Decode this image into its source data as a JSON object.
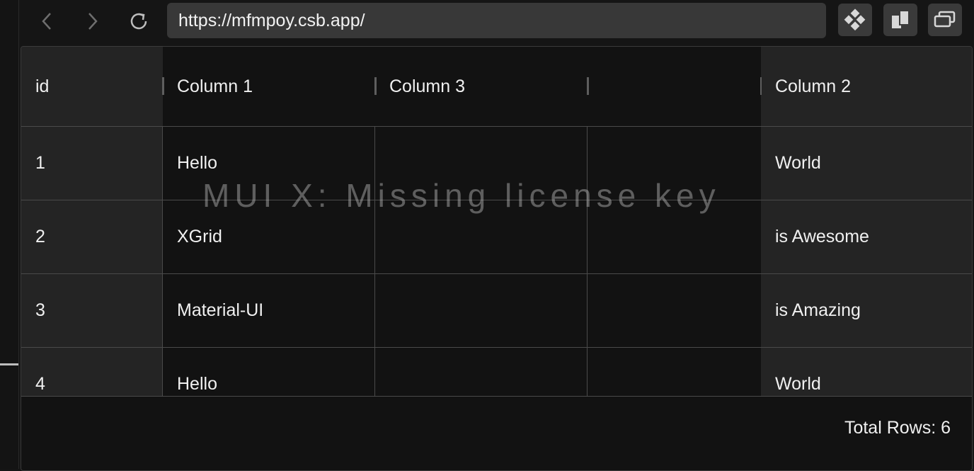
{
  "browser": {
    "url": "https://mfmpoy.csb.app/",
    "back_icon": "chevron-left-icon",
    "forward_icon": "chevron-right-icon",
    "reload_icon": "reload-icon",
    "toolbar_icons": [
      "diamond-grid-icon",
      "split-panels-icon",
      "windows-icon"
    ]
  },
  "grid": {
    "columns": [
      {
        "key": "id",
        "label": "id"
      },
      {
        "key": "col1",
        "label": "Column 1"
      },
      {
        "key": "col3",
        "label": "Column 3"
      },
      {
        "key": "blank",
        "label": ""
      },
      {
        "key": "col2",
        "label": "Column 2"
      }
    ],
    "rows": [
      {
        "id": "1",
        "col1": "Hello",
        "col3": "",
        "blank": "",
        "col2": "World"
      },
      {
        "id": "2",
        "col1": "XGrid",
        "col3": "",
        "blank": "",
        "col2": "is Awesome"
      },
      {
        "id": "3",
        "col1": "Material-UI",
        "col3": "",
        "blank": "",
        "col2": "is Amazing"
      },
      {
        "id": "4",
        "col1": "Hello",
        "col3": "",
        "blank": "",
        "col2": "World"
      }
    ],
    "watermark": "MUI X: Missing license key",
    "footer": {
      "total_rows": "Total Rows: 6"
    }
  },
  "colors": {
    "background": "#151515",
    "pinned_column": "#242424",
    "grid_body": "#121212",
    "url_bar": "#383838"
  }
}
